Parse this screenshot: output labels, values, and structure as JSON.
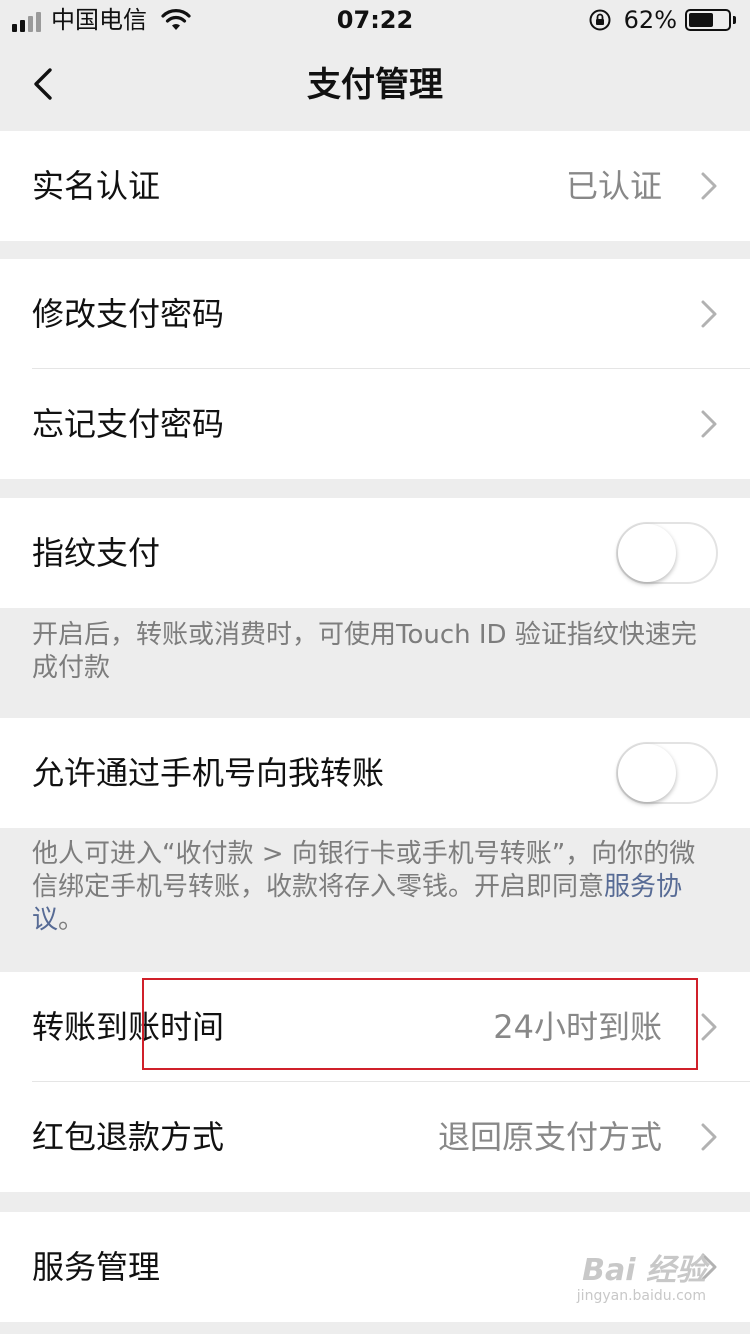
{
  "status_bar": {
    "carrier": "中国电信",
    "time": "07:22",
    "battery_percent": "62%",
    "battery_level": 0.62,
    "icons": [
      "signal-icon",
      "wifi-icon",
      "rotation-lock-icon",
      "battery-icon"
    ]
  },
  "nav": {
    "title": "支付管理",
    "back_icon": "chevron-left-icon"
  },
  "sections": {
    "realname": {
      "label": "实名认证",
      "value": "已认证"
    },
    "password": {
      "modify_label": "修改支付密码",
      "forgot_label": "忘记支付密码"
    },
    "fingerprint": {
      "label": "指纹支付",
      "enabled": false,
      "note": "开启后，转账或消费时，可使用Touch ID 验证指纹快速完成付款"
    },
    "phone_transfer": {
      "label": "允许通过手机号向我转账",
      "enabled": false,
      "note_text": "他人可进入“收付款 > 向银行卡或手机号转账”，向你的微信绑定手机号转账，收款将存入零钱。开启即同意",
      "note_link": "服务协议",
      "note_end": "。"
    },
    "transfer": {
      "arrival_label": "转账到账时间",
      "arrival_value": "24小时到账",
      "refund_label": "红包退款方式",
      "refund_value": "退回原支付方式"
    },
    "service": {
      "label": "服务管理"
    }
  },
  "annotation": {
    "color": "#d0202a"
  },
  "watermark": {
    "main": "Bai 经验",
    "sub": "jingyan.baidu.com"
  },
  "colors": {
    "background": "#ededed",
    "link": "#576b95",
    "secondary_text": "#888888"
  }
}
